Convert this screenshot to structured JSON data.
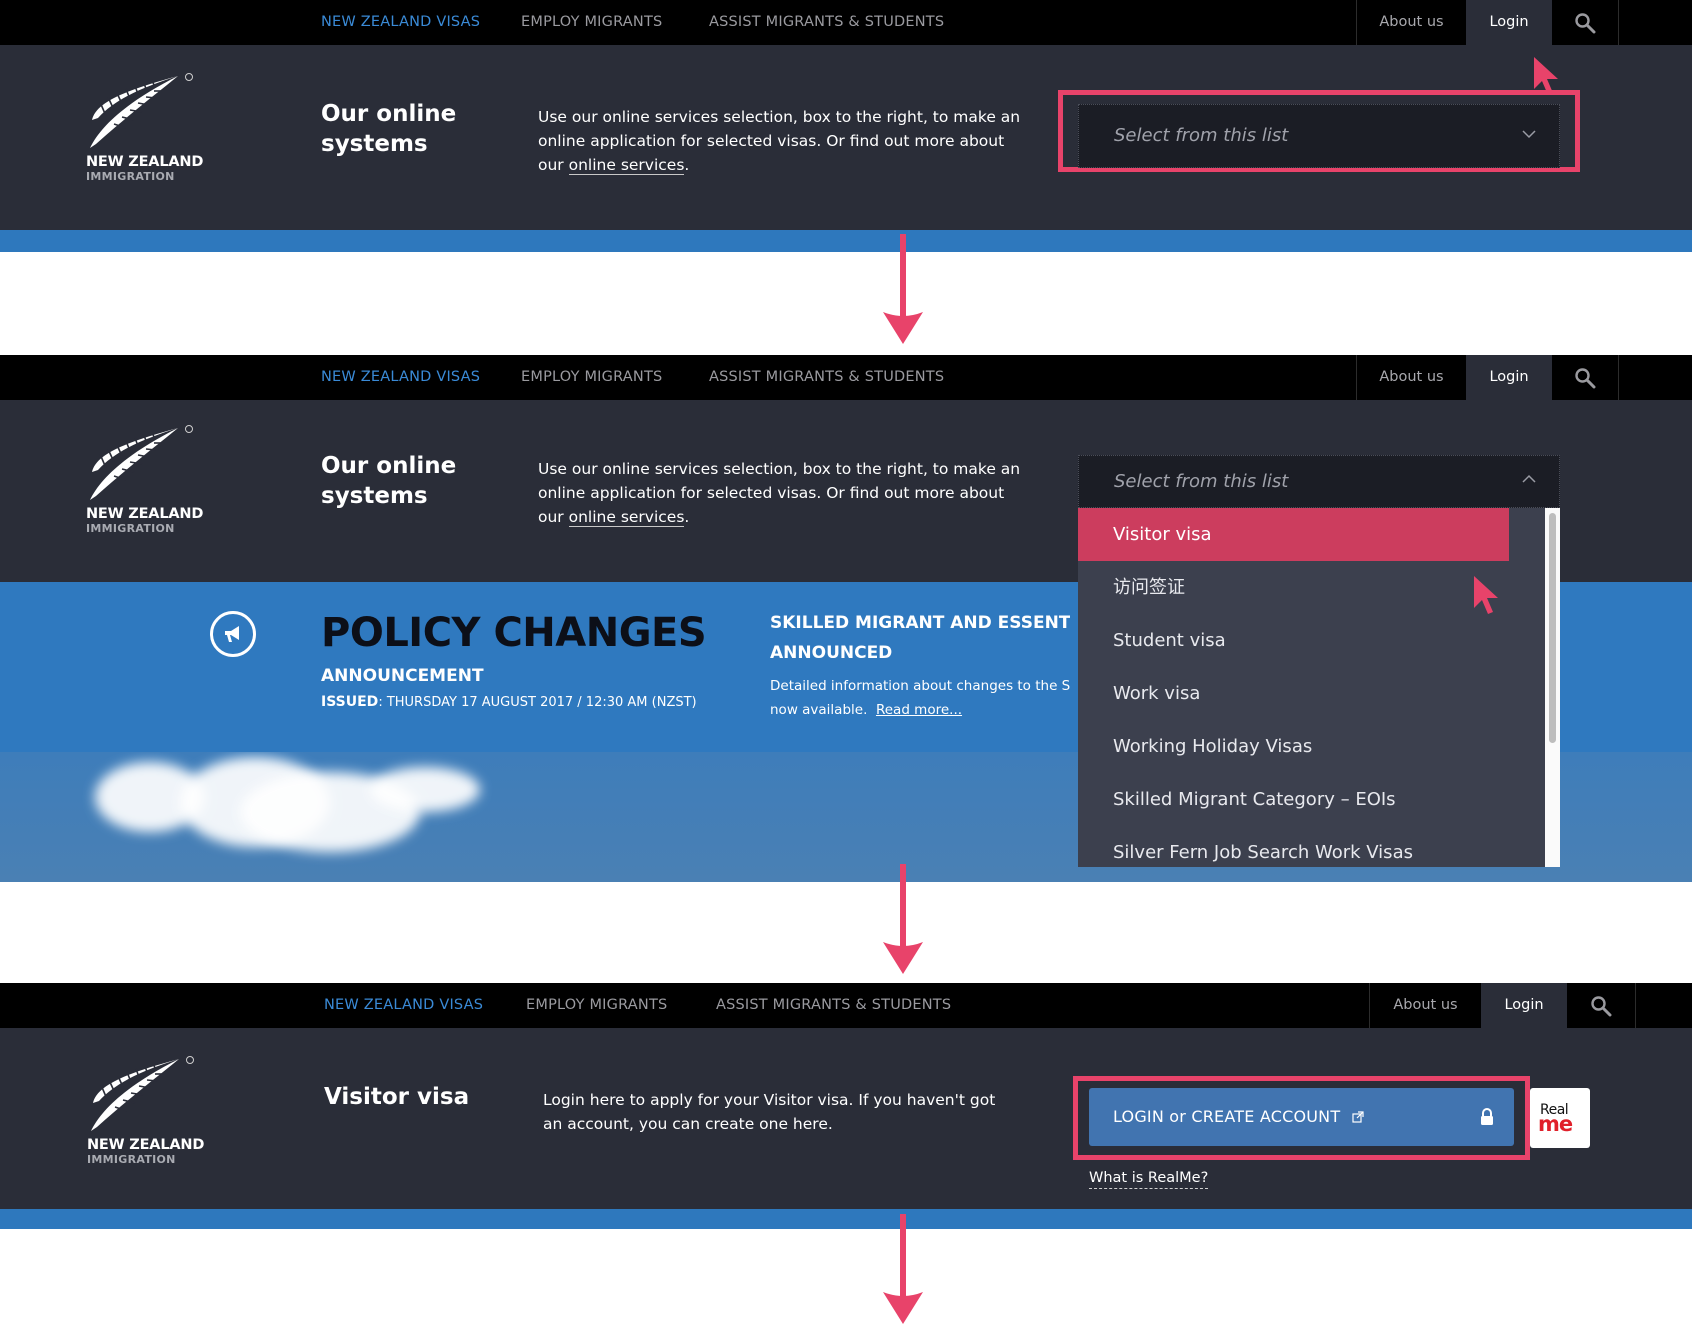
{
  "colors": {
    "nav_bg": "#000000",
    "hero_bg": "#2a2d38",
    "accent_blue": "#2e78bd",
    "active_nav": "#3a8ad6",
    "highlight_pink": "#e8436a",
    "selected_item": "#cc3d5e",
    "login_button": "#4174b0"
  },
  "nav": {
    "links": [
      "NEW ZEALAND VISAS",
      "EMPLOY MIGRANTS",
      "ASSIST MIGRANTS & STUDENTS"
    ],
    "active_index": 0,
    "about": "About us",
    "login": "Login",
    "search_icon": "search-icon"
  },
  "logo": {
    "line1": "NEW ZEALAND",
    "line2": "IMMIGRATION",
    "icon": "silver-fern-icon"
  },
  "step1": {
    "title": "Our online systems",
    "description_prefix": "Use our online services selection, box to the right, to make an online application for selected visas. Or find out more about our ",
    "description_link": "online services",
    "description_suffix": ".",
    "select_placeholder": "Select from this list",
    "select_icon": "chevron-down-icon"
  },
  "step2": {
    "title": "Our online systems",
    "description_prefix": "Use our online services selection, box to the right, to make an online application for selected visas. Or find out more about our ",
    "description_link": "online services",
    "description_suffix": ".",
    "banner": {
      "icon": "megaphone-icon",
      "title": "POLICY CHANGES",
      "subtitle": "ANNOUNCEMENT",
      "issued_label": "ISSUED",
      "issued_value": ": THURSDAY 17 AUGUST 2017 / 12:30 AM (NZST)",
      "news_title_line1": "SKILLED MIGRANT AND ESSENTIA",
      "news_title_line2": "ANNOUNCED",
      "news_body_line1": "Detailed information about changes to the Skill",
      "news_body_line2": "now available.",
      "read_more": "Read more..."
    },
    "dropdown": {
      "placeholder": "Select from this list",
      "icon": "chevron-up-icon",
      "options": [
        "Visitor visa",
        "访问签证",
        "Student visa",
        "Work visa",
        "Working Holiday Visas",
        "Skilled Migrant Category – EOIs",
        "Silver Fern Job Search Work Visas"
      ],
      "selected_index": 0
    }
  },
  "step3": {
    "title": "Visitor visa",
    "description": "Login here to apply for your Visitor visa. If you haven't got an account, you can create one here.",
    "login_button": "LOGIN or CREATE ACCOUNT",
    "external_icon": "external-link-icon",
    "lock_icon": "lock-icon",
    "realme_line1": "Real",
    "realme_line2": "me",
    "what_is_realme": "What is RealMe?"
  }
}
